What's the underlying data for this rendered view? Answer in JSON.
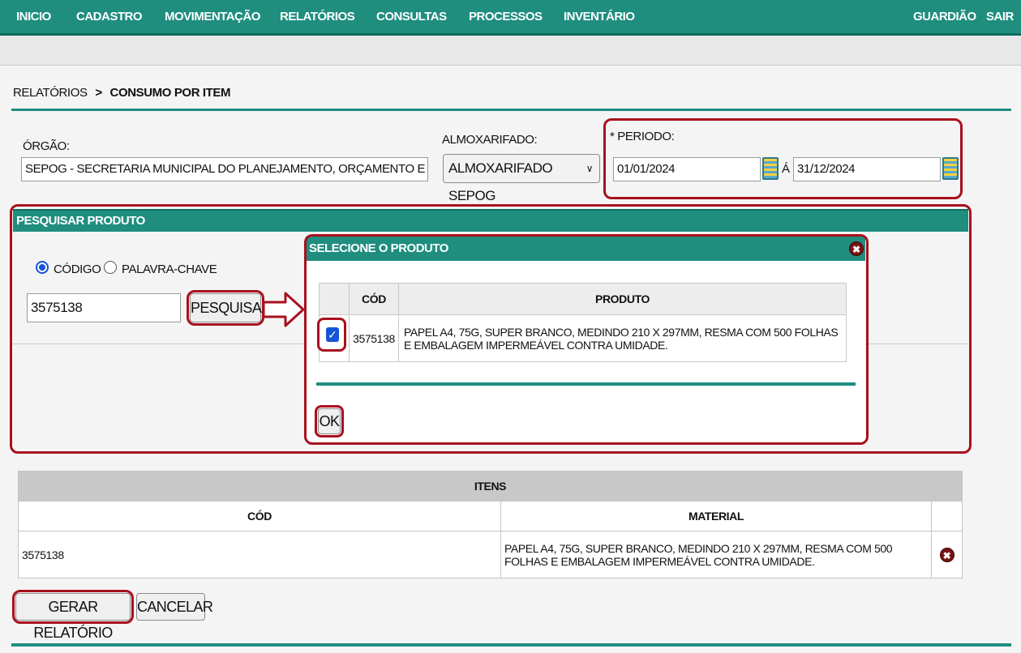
{
  "nav": {
    "items": [
      "INICIO",
      "CADASTRO",
      "MOVIMENTAÇÃO",
      "RELATÓRIOS",
      "CONSULTAS",
      "PROCESSOS",
      "INVENTÁRIO"
    ],
    "right": [
      "GUARDIÃO",
      "SAIR"
    ]
  },
  "breadcrumb": {
    "section": "RELATÓRIOS",
    "separator": ">",
    "current": "CONSUMO POR ITEM"
  },
  "form": {
    "orgao_label": "ÓRGÃO:",
    "orgao_value": "SEPOG - SECRETARIA MUNICIPAL DO PLANEJAMENTO, ORÇAMENTO E GESTÃO",
    "almox_label": "ALMOXARIFADO:",
    "almox_value": "ALMOXARIFADO SEPOG",
    "periodo_label": "* PERIODO:",
    "date_start": "01/01/2024",
    "date_sep": "Á",
    "date_end": "31/12/2024"
  },
  "search": {
    "title": "PESQUISAR PRODUTO",
    "opt_code": "CÓDIGO",
    "opt_keyword": "PALAVRA-CHAVE",
    "input_value": "3575138",
    "button": "PESQUISAR"
  },
  "modal": {
    "title": "SELECIONE O PRODUTO",
    "col_code": "CÓD",
    "col_product": "PRODUTO",
    "row_code": "3575138",
    "row_product": "PAPEL A4, 75G, SUPER BRANCO, MEDINDO 210 X 297MM, RESMA COM 500 FOLHAS E EMBALAGEM IMPERMEÁVEL CONTRA UMIDADE.",
    "ok": "OK"
  },
  "items": {
    "title": "ITENS",
    "col_code": "CÓD",
    "col_material": "MATERIAL",
    "rows": [
      {
        "code": "3575138",
        "material": "PAPEL A4, 75G, SUPER BRANCO, MEDINDO 210 X 297MM, RESMA COM 500 FOLHAS E EMBALAGEM IMPERMEÁVEL CONTRA UMIDADE."
      }
    ]
  },
  "actions": {
    "generate": "GERAR RELATÓRIO",
    "cancel": "CANCELAR"
  },
  "colors": {
    "nav": "#1f8e7f",
    "highlight": "#a8101d",
    "checkbox": "#1553d8"
  }
}
